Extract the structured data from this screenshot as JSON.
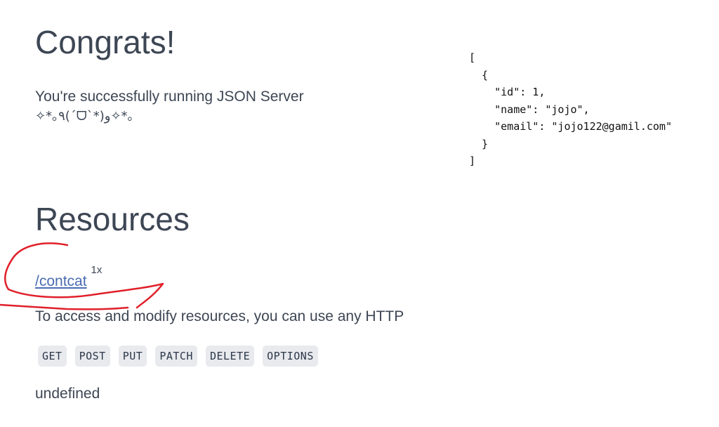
{
  "hero": {
    "title": "Congrats!",
    "line1": "You're successfully running JSON Server",
    "line2": "✧*｡٩(ˊᗜˋ*)و✧*｡"
  },
  "json_preview": {
    "text": "[\n  {\n    \"id\": 1,\n    \"name\": \"jojo\",\n    \"email\": \"jojo122@gamil.com\"\n  }\n]"
  },
  "resources": {
    "title": "Resources",
    "items": [
      {
        "path": "/contcat",
        "count": "1x"
      }
    ],
    "http_text": "To access and modify resources, you can use any HTTP",
    "methods": [
      "GET",
      "POST",
      "PUT",
      "PATCH",
      "DELETE",
      "OPTIONS"
    ],
    "footer_text": "undefined"
  },
  "annotation": {
    "color": "#e0202a"
  }
}
